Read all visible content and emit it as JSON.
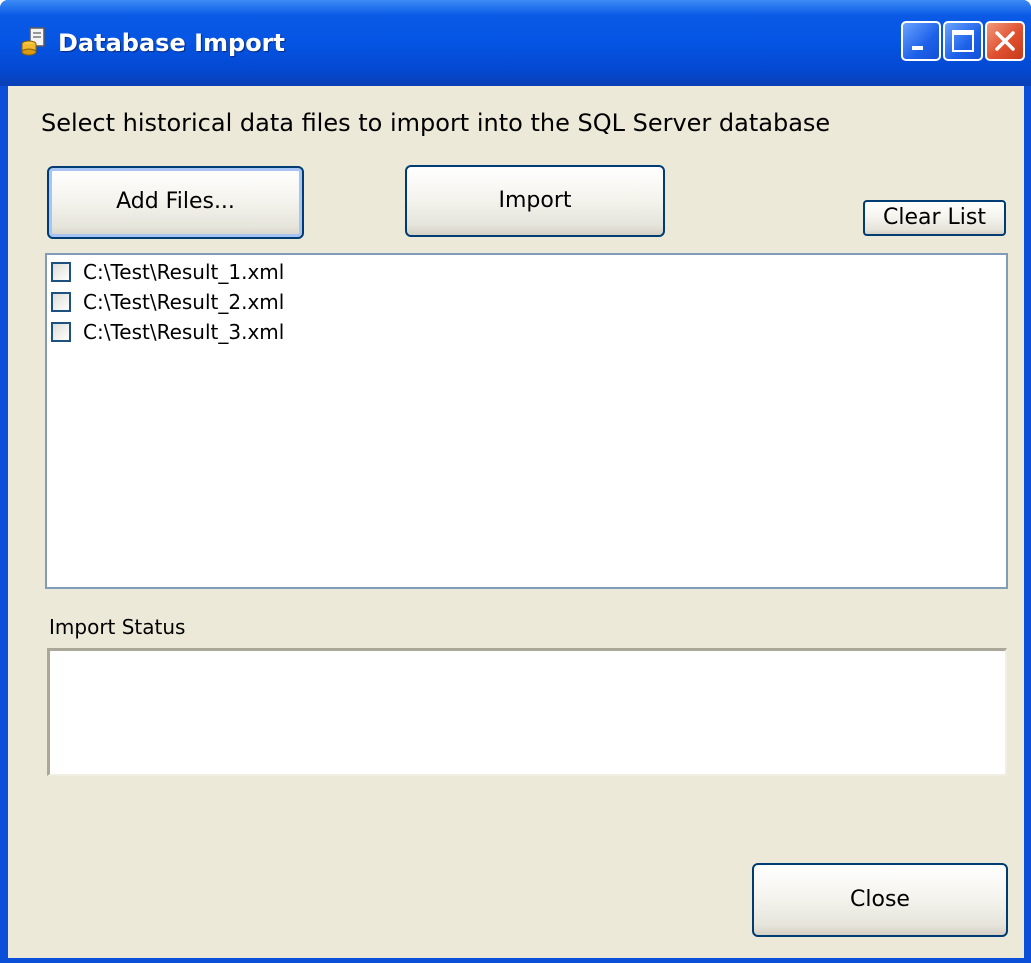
{
  "window": {
    "title": "Database Import",
    "icon": "database-import-app-icon",
    "controls": [
      "minimize",
      "maximize",
      "close"
    ]
  },
  "instructions": "Select historical data files to import into the SQL Server database",
  "buttons": {
    "add_files": "Add Files...",
    "import": "Import",
    "clear_list": "Clear List",
    "close": "Close"
  },
  "file_list": [
    {
      "path": "C:\\Test\\Result_1.xml",
      "checked": false
    },
    {
      "path": "C:\\Test\\Result_2.xml",
      "checked": false
    },
    {
      "path": "C:\\Test\\Result_3.xml",
      "checked": false
    }
  ],
  "status": {
    "label": "Import Status",
    "text": ""
  },
  "colors": {
    "titlebar": "#0554e3",
    "client_background": "#ece9d8",
    "button_border": "#003c74",
    "list_border": "#7f9db9"
  }
}
